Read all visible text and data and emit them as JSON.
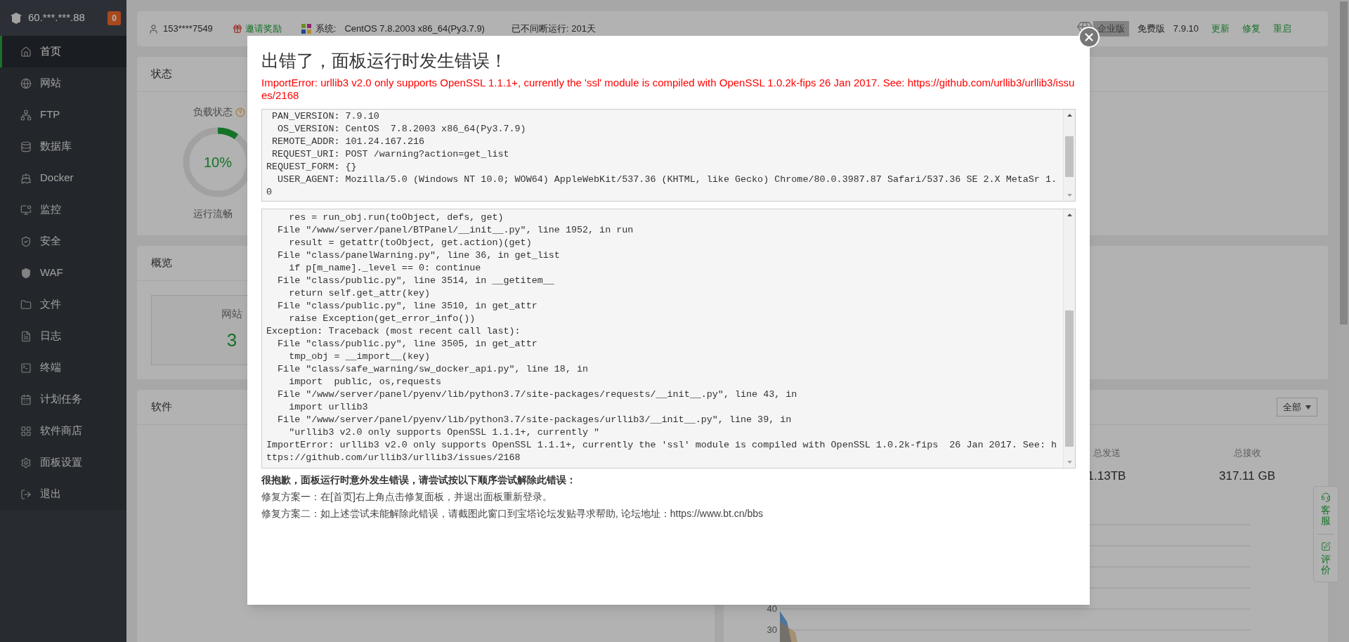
{
  "sidebar": {
    "host": "60.***.***.88",
    "badge": "0",
    "items": [
      {
        "label": "首页",
        "selected": true
      },
      {
        "label": "网站",
        "selected": false
      },
      {
        "label": "FTP",
        "selected": false
      },
      {
        "label": "数据库",
        "selected": false
      },
      {
        "label": "Docker",
        "selected": false
      },
      {
        "label": "监控",
        "selected": false
      },
      {
        "label": "安全",
        "selected": false
      },
      {
        "label": "WAF",
        "selected": false
      },
      {
        "label": "文件",
        "selected": false
      },
      {
        "label": "日志",
        "selected": false
      },
      {
        "label": "终端",
        "selected": false
      },
      {
        "label": "计划任务",
        "selected": false
      },
      {
        "label": "软件商店",
        "selected": false
      },
      {
        "label": "面板设置",
        "selected": false
      },
      {
        "label": "退出",
        "selected": false
      }
    ]
  },
  "topbar": {
    "user": "153****7549",
    "invite": "邀请奖励",
    "system_label": "系统:",
    "system": "CentOS 7.8.2003 x86_64(Py3.7.9)",
    "uptime": "已不间断运行: 201天",
    "edition": "企业版",
    "plan": "免费版",
    "version": "7.9.10",
    "links": [
      "更新",
      "修复",
      "重启"
    ]
  },
  "status_card": {
    "title": "状态",
    "gauge_label": "负载状态",
    "gauge_value": "10%",
    "level": 0.1,
    "gauge_caption": "运行流畅"
  },
  "overview_card": {
    "title": "概览",
    "tiles": [
      {
        "label": "网站",
        "value": "3"
      }
    ]
  },
  "software_card": {
    "title": "软件"
  },
  "traffic_card": {
    "filter": "全部",
    "stats": [
      {
        "label": "总发送",
        "value": "1.13TB"
      },
      {
        "label": "总接收",
        "value": "317.11 GB"
      }
    ],
    "y_ticks": [
      "40",
      "30"
    ]
  },
  "float_widget": [
    "客服",
    "评价"
  ],
  "dialog": {
    "title": "出错了，面板运行时发生错误！",
    "error": "ImportError: urllib3 v2.0 only supports OpenSSL 1.1.1+, currently the 'ssl' module is compiled with OpenSSL 1.0.2k-fips 26 Jan 2017. See: https://github.com/urllib3/urllib3/issues/2168",
    "env": [
      " PAN_VERSION: 7.9.10",
      "  OS_VERSION: CentOS  7.8.2003 x86_64(Py3.7.9)",
      " REMOTE_ADDR: 101.24.167.216",
      " REQUEST_URI: POST /warning?action=get_list",
      "REQUEST_FORM: {}",
      "  USER_AGENT: Mozilla/5.0 (Windows NT 10.0; WOW64) AppleWebKit/537.36 (KHTML, like Gecko) Chrome/80.0.3987.87 Safari/537.36 SE 2.X MetaSr 1.0"
    ],
    "traceback": [
      "    res = run_obj.run(toObject, defs, get)",
      "  File \"/www/server/panel/BTPanel/__init__.py\", line 1952, in run",
      "    result = getattr(toObject, get.action)(get)",
      "  File \"class/panelWarning.py\", line 36, in get_list",
      "    if p[m_name]._level == 0: continue",
      "  File \"class/public.py\", line 3514, in __getitem__",
      "    return self.get_attr(key)",
      "  File \"class/public.py\", line 3510, in get_attr",
      "    raise Exception(get_error_info())",
      "Exception: Traceback (most recent call last):",
      "  File \"class/public.py\", line 3505, in get_attr",
      "    tmp_obj = __import__(key)",
      "  File \"class/safe_warning/sw_docker_api.py\", line 18, in",
      "    import  public, os,requests",
      "  File \"/www/server/panel/pyenv/lib/python3.7/site-packages/requests/__init__.py\", line 43, in",
      "    import urllib3",
      "  File \"/www/server/panel/pyenv/lib/python3.7/site-packages/urllib3/__init__.py\", line 39, in",
      "    \"urllib3 v2.0 only supports OpenSSL 1.1.1+, currently \"",
      "ImportError: urllib3 v2.0 only supports OpenSSL 1.1.1+, currently the 'ssl' module is compiled with OpenSSL 1.0.2k-fips  26 Jan 2017. See: https://github.com/urllib3/urllib3/issues/2168"
    ],
    "apology": "很抱歉，面板运行时意外发生错误，请尝试按以下顺序尝试解除此错误：",
    "fixes": [
      "修复方案一：在[首页]右上角点击修复面板，并退出面板重新登录。",
      "修复方案二：如上述尝试未能解除此错误，请截图此窗口到宝塔论坛发贴寻求帮助, 论坛地址：https://www.bt.cn/bbs"
    ]
  }
}
